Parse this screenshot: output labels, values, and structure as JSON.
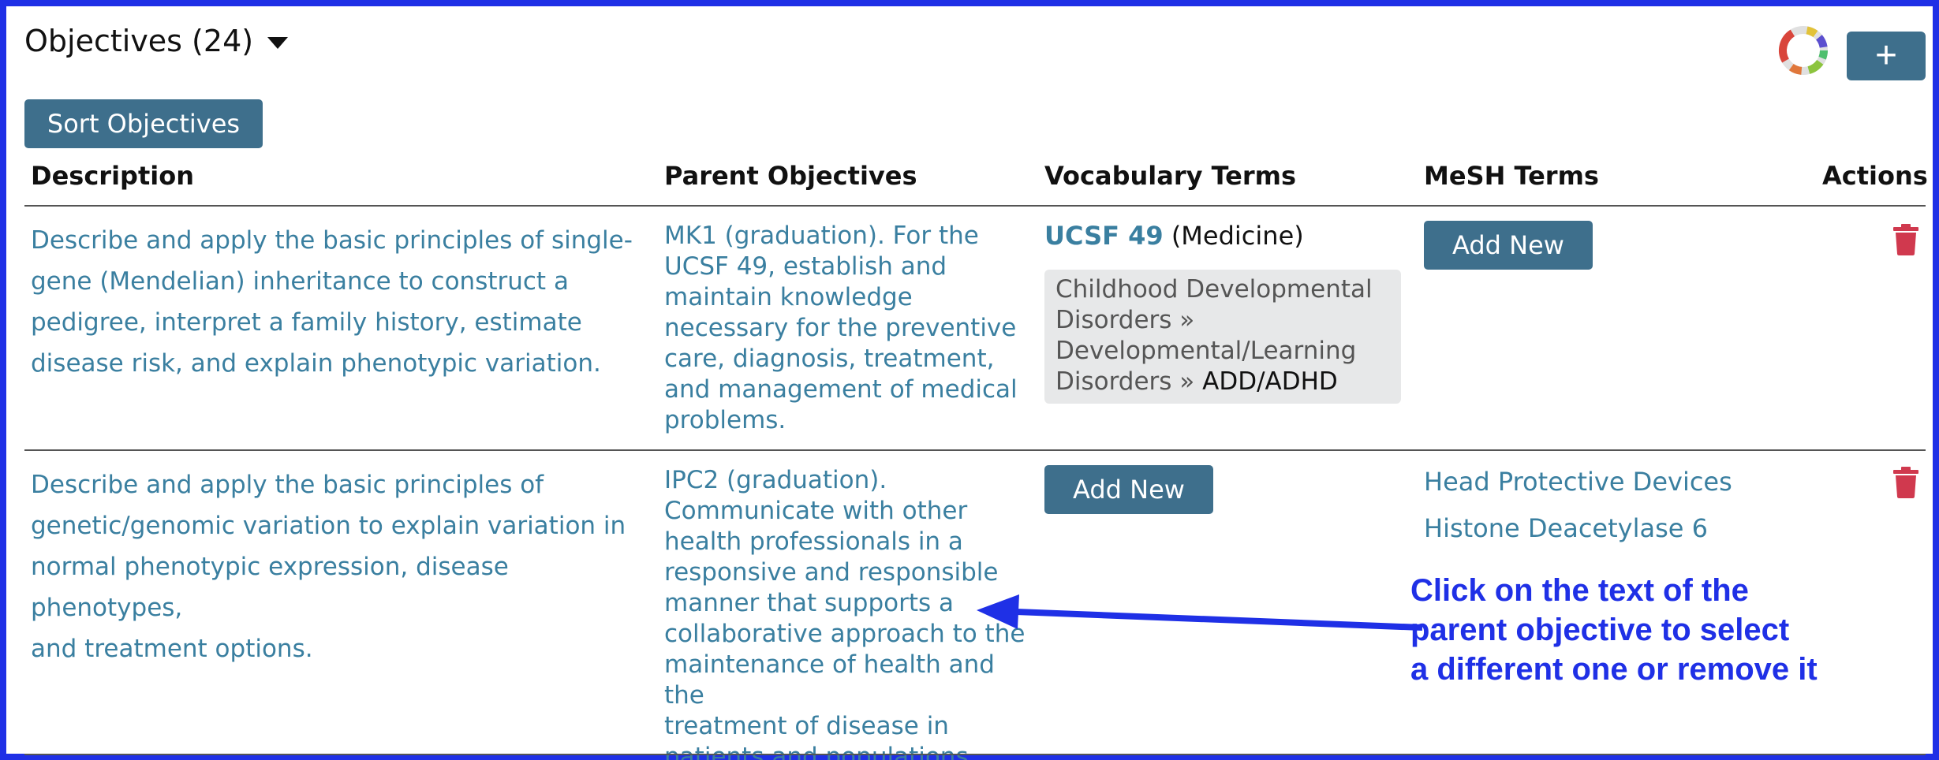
{
  "header": {
    "title": "Objectives (24)"
  },
  "toolbar": {
    "add_symbol": "+",
    "sort_label": "Sort Objectives"
  },
  "table": {
    "columns": [
      "Description",
      "Parent Objectives",
      "Vocabulary Terms",
      "MeSH Terms",
      "Actions"
    ],
    "rows": [
      {
        "description": [
          "Describe and apply the basic principles of single-",
          "gene (Mendelian) inheritance to construct a",
          "pedigree, interpret a family history, estimate",
          "disease risk, and explain phenotypic variation."
        ],
        "parent": [
          "MK1 (graduation). For the",
          "UCSF 49, establish and",
          "maintain knowledge",
          "necessary for the preventive",
          "care, diagnosis, treatment,",
          "and management of medical",
          "problems."
        ],
        "vocab_term": "UCSF 49",
        "vocab_category": "(Medicine)",
        "vocab_path": [
          "Childhood Developmental",
          "Disorders »",
          "Developmental/Learning",
          "Disorders »"
        ],
        "vocab_leaf": "ADD/ADHD",
        "mesh_button": "Add New"
      },
      {
        "description": [
          "Describe and apply the basic principles of",
          "genetic/genomic variation to explain variation in",
          "normal phenotypic expression, disease phenotypes,",
          "and treatment options."
        ],
        "parent": [
          "IPC2 (graduation).",
          "Communicate with other",
          "health professionals in a",
          "responsive and responsible",
          "manner that supports a",
          "collaborative approach to the",
          "maintenance of health and the",
          "treatment of disease in",
          "patients and populations."
        ],
        "vocab_button": "Add New",
        "mesh_terms": [
          "Head Protective Devices",
          "Histone Deacetylase 6"
        ]
      }
    ]
  },
  "annotation": {
    "lines": [
      "Click on the text of the",
      "parent objective to select",
      "a different one or remove it"
    ]
  },
  "colors": {
    "accent": "#3e6f8c",
    "link": "#3a7fa0",
    "danger": "#d0394e",
    "annotation": "#1f30e6"
  }
}
